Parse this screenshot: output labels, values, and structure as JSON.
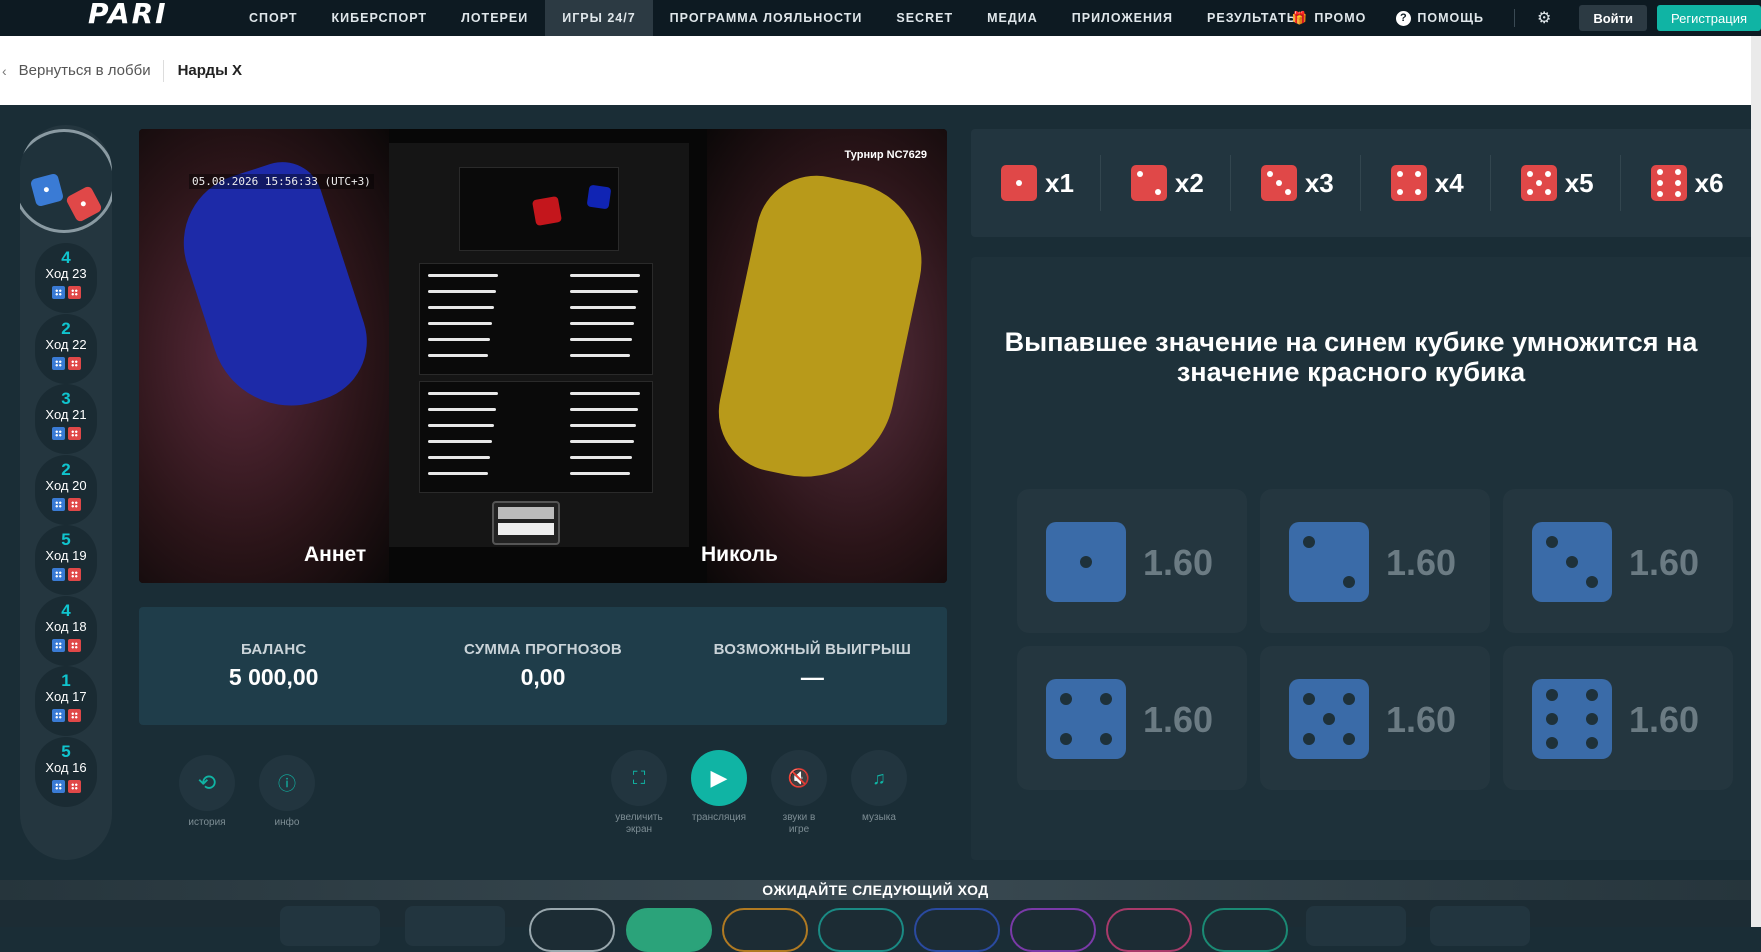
{
  "nav": {
    "logo": "PARI",
    "items": [
      "СПОРТ",
      "КИБЕРСПОРТ",
      "ЛОТЕРЕИ",
      "ИГРЫ 24/7",
      "ПРОГРАММА ЛОЯЛЬНОСТИ",
      "SECRET",
      "МЕДИА",
      "ПРИЛОЖЕНИЯ",
      "РЕЗУЛЬТАТЫ"
    ],
    "active_item": "ИГРЫ 24/7",
    "promo": "ПРОМО",
    "help": "ПОМОЩЬ",
    "login": "Войти",
    "register": "Регистрация",
    "accent_color": "#10b4a4"
  },
  "breadcrumb": {
    "back": "Вернуться в лобби",
    "current": "Нарды X"
  },
  "history": [
    {
      "value": "4",
      "turn": "Ход 23"
    },
    {
      "value": "2",
      "turn": "Ход 22"
    },
    {
      "value": "3",
      "turn": "Ход 21"
    },
    {
      "value": "2",
      "turn": "Ход 20"
    },
    {
      "value": "5",
      "turn": "Ход 19"
    },
    {
      "value": "4",
      "turn": "Ход 18"
    },
    {
      "value": "1",
      "turn": "Ход 17"
    },
    {
      "value": "5",
      "turn": "Ход 16"
    }
  ],
  "video": {
    "timestamp": "05.08.2026 15:56:33 (UTC+3)",
    "tournament": "Турнир NC7629",
    "player_left": "Аннет",
    "player_right": "Николь"
  },
  "balance": {
    "balance_label": "БАЛАНС",
    "balance_value": "5 000,00",
    "sum_label": "СУММА ПРОГНОЗОВ",
    "sum_value": "0,00",
    "win_label": "ВОЗМОЖНЫЙ ВЫИГРЫШ",
    "win_value": "—"
  },
  "controls": {
    "history": "история",
    "info": "инфо",
    "fullscreen": "увеличить экран",
    "stream": "трансляция",
    "sounds": "звуки в игре",
    "music": "музыка"
  },
  "multipliers": [
    "x1",
    "x2",
    "x3",
    "x4",
    "x5",
    "x6"
  ],
  "rules_text": "Выпавшее значение на синем кубике умножится на значение красного кубика",
  "bets": [
    {
      "die": 1,
      "coef": "1.60"
    },
    {
      "die": 2,
      "coef": "1.60"
    },
    {
      "die": 3,
      "coef": "1.60"
    },
    {
      "die": 4,
      "coef": "1.60"
    },
    {
      "die": 5,
      "coef": "1.60"
    },
    {
      "die": 6,
      "coef": "1.60"
    }
  ],
  "status": "ОЖИДАЙТЕ СЛЕДУЮЩИЙ ХОД"
}
